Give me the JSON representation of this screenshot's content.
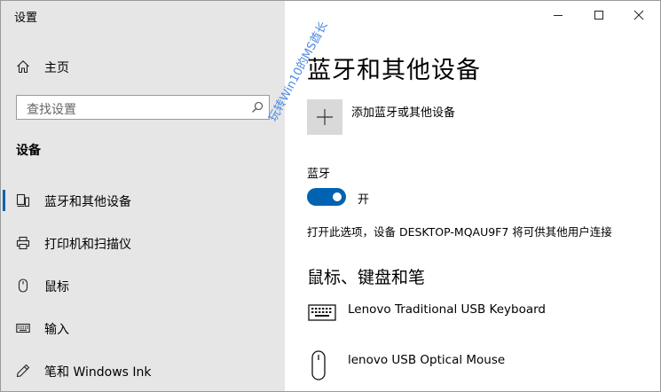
{
  "window": {
    "title": "设置"
  },
  "sidebar": {
    "home_label": "主页",
    "search_placeholder": "查找设置",
    "section_label": "设备",
    "items": [
      {
        "label": "蓝牙和其他设备",
        "icon": "bluetooth-devices-icon",
        "selected": true
      },
      {
        "label": "打印机和扫描仪",
        "icon": "printer-icon",
        "selected": false
      },
      {
        "label": "鼠标",
        "icon": "mouse-icon",
        "selected": false
      },
      {
        "label": "输入",
        "icon": "keyboard-icon",
        "selected": false
      },
      {
        "label": "笔和 Windows Ink",
        "icon": "pen-icon",
        "selected": false
      }
    ]
  },
  "main": {
    "title": "蓝牙和其他设备",
    "add_device_label": "添加蓝牙或其他设备",
    "bluetooth_header": "蓝牙",
    "bluetooth_state": "开",
    "bluetooth_on": true,
    "discoverable_note": "打开此选项，设备 DESKTOP-MQAU9F7 将可供其他用户连接",
    "peripherals_title": "鼠标、键盘和笔",
    "devices": [
      {
        "name": "Lenovo Traditional USB Keyboard",
        "icon": "keyboard-device-icon"
      },
      {
        "name": "lenovo USB Optical Mouse",
        "icon": "mouse-device-icon"
      }
    ]
  },
  "watermark": "玩转Win10的MS酋长",
  "colors": {
    "accent": "#0063b1",
    "sidebar_bg": "#e6e6e6",
    "tile_bg": "#d9d9d9"
  }
}
